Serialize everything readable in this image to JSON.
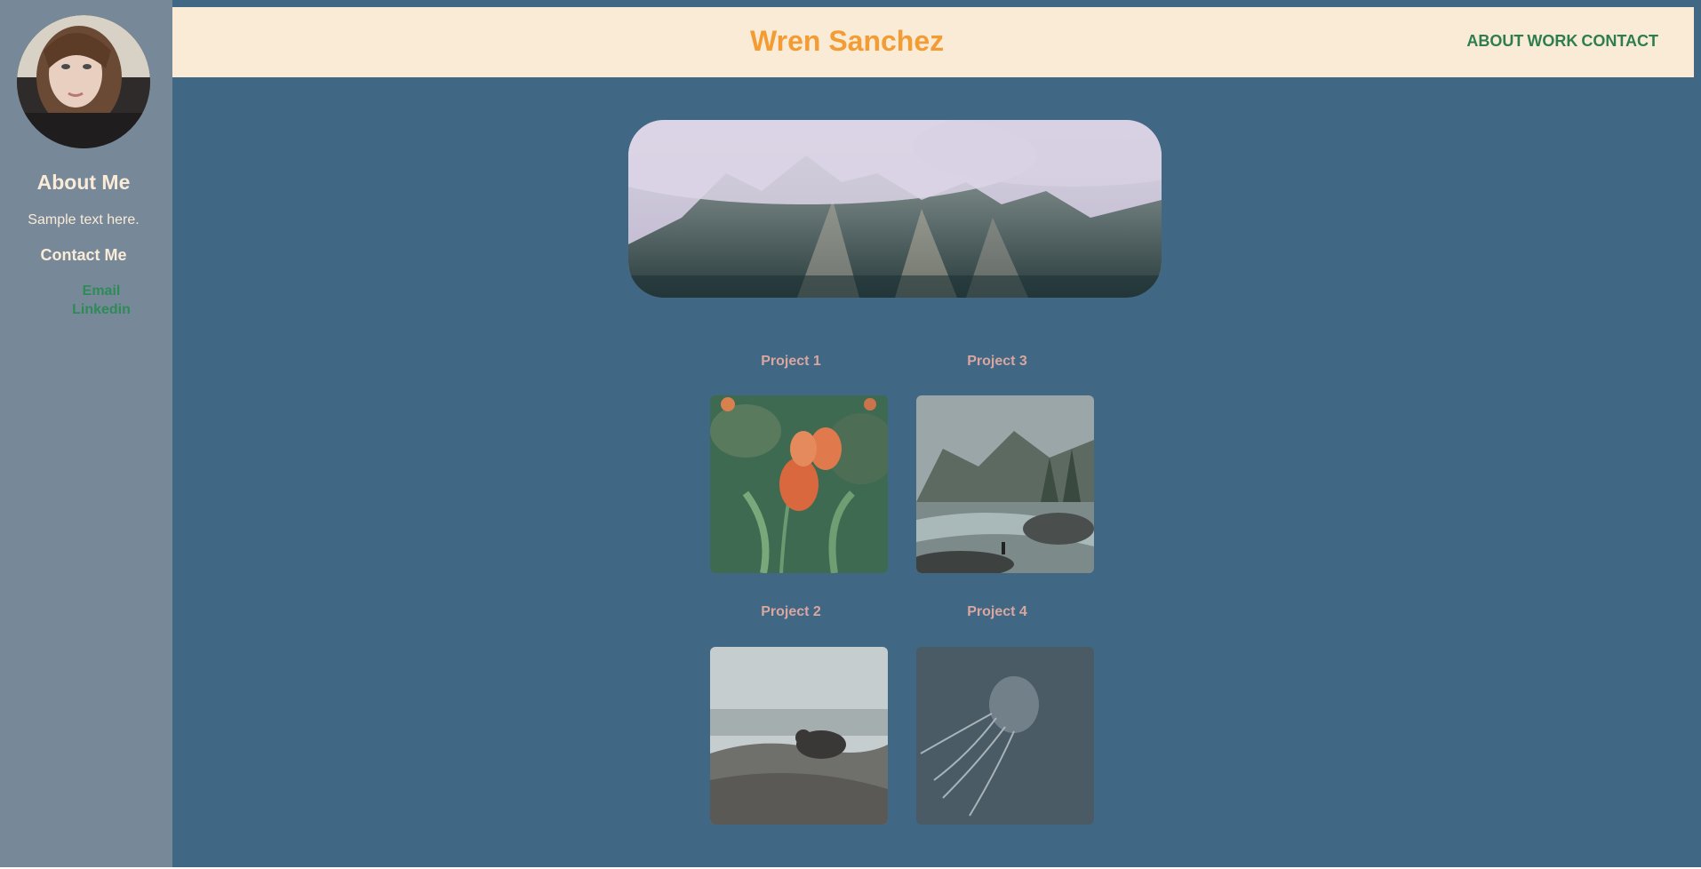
{
  "sidebar": {
    "avatar_icon": "profile-photo",
    "about_heading": "About Me",
    "about_text": "Sample text here.",
    "contact_heading": "Contact Me",
    "links": [
      {
        "label": "Email"
      },
      {
        "label": "Linkedin"
      }
    ]
  },
  "header": {
    "title": "Wren Sanchez",
    "nav": [
      {
        "label": "ABOUT"
      },
      {
        "label": "WORK"
      },
      {
        "label": "CONTACT"
      }
    ]
  },
  "main": {
    "hero_image": "misty-mountains",
    "projects": [
      {
        "title": "Project 1",
        "image": "orange-tulips"
      },
      {
        "title": "Project 3",
        "image": "river-valley-hiker"
      },
      {
        "title": "Project 2",
        "image": "bear-on-rocks"
      },
      {
        "title": "Project 4",
        "image": "jellyfish"
      }
    ]
  },
  "colors": {
    "page_bg": "#406783",
    "sidebar_bg": "#778899",
    "header_bg": "#faebd7",
    "title": "#f39c34",
    "nav_link": "#2e7d4f",
    "project_title": "#d9a6a0"
  }
}
